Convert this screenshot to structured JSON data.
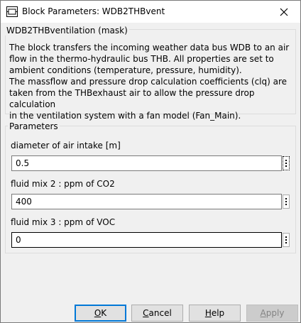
{
  "window": {
    "title": "Block Parameters: WDB2THBvent"
  },
  "mask": {
    "title": "WDB2THBventilation (mask)",
    "description": [
      "The block transfers the incoming weather data bus WDB to an air",
      "flow in the thermo-hydraulic bus THB. All properties are set to",
      "ambient conditions (temperature, pressure, humidity).",
      "The massflow and pressure drop calculation coefficients (clq) are",
      "taken from the THBexhaust air to allow the pressure drop calculation",
      "in the ventilation system with a fan model (Fan_Main)."
    ]
  },
  "parameters": {
    "title": "Parameters",
    "fields": [
      {
        "label": "diameter of air intake [m]",
        "value": "0.5"
      },
      {
        "label": "fluid mix 2 : ppm of CO2",
        "value": "400"
      },
      {
        "label": "fluid mix 3 : ppm of VOC",
        "value": "0"
      }
    ]
  },
  "buttons": {
    "ok": {
      "first": "O",
      "rest": "K"
    },
    "cancel": {
      "first": "C",
      "rest": "ancel"
    },
    "help": {
      "first": "H",
      "rest": "elp"
    },
    "apply": {
      "first": "A",
      "rest": "pply"
    }
  },
  "icons": {
    "app": "simulink-block-icon",
    "close": "close-icon",
    "more": "vertical-ellipsis-icon"
  },
  "colors": {
    "accent": "#0078d7",
    "dialog_bg": "#f0f0f0"
  }
}
